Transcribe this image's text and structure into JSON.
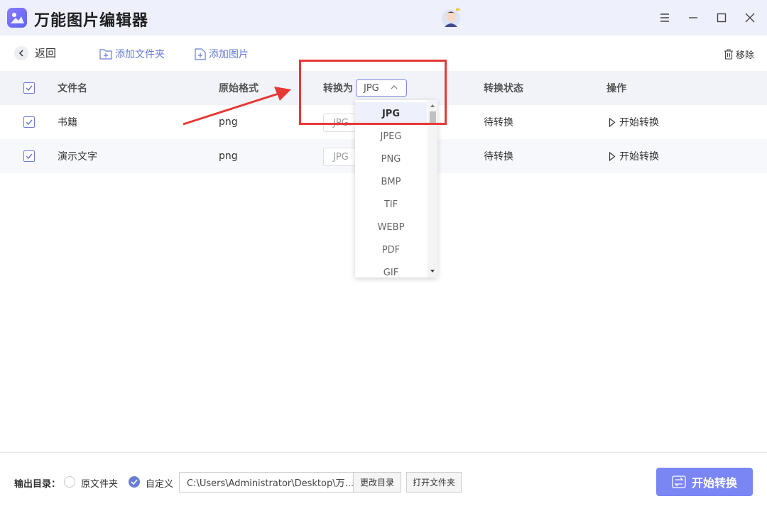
{
  "app": {
    "title": "万能图片编辑器"
  },
  "toolbar": {
    "back_label": "返回",
    "add_folder_label": "添加文件夹",
    "add_image_label": "添加图片",
    "remove_label": "移除"
  },
  "table": {
    "headers": {
      "filename": "文件名",
      "original_format": "原始格式",
      "convert_to": "转换为",
      "status": "转换状态",
      "action": "操作"
    },
    "header_format_value": "JPG",
    "rows": [
      {
        "filename": "书籍",
        "original_format": "png",
        "target_format": "JPG",
        "status": "待转换",
        "action": "开始转换"
      },
      {
        "filename": "演示文字",
        "original_format": "png",
        "target_format": "JPG",
        "status": "待转换",
        "action": "开始转换"
      }
    ]
  },
  "dropdown": {
    "options": [
      "JPG",
      "JPEG",
      "PNG",
      "BMP",
      "TIF",
      "WEBP",
      "PDF",
      "GIF"
    ],
    "selected": "JPG"
  },
  "footer": {
    "output_label": "输出目录：",
    "option_original": "原文件夹",
    "option_custom": "自定义",
    "path": "C:\\Users\\Administrator\\Desktop\\万...",
    "change_dir_label": "更改目录",
    "open_folder_label": "打开文件夹",
    "start_label": "开始转换"
  },
  "colors": {
    "accent": "#6b7bd6",
    "primary_button": "#7b86f5",
    "highlight": "#e53935"
  }
}
